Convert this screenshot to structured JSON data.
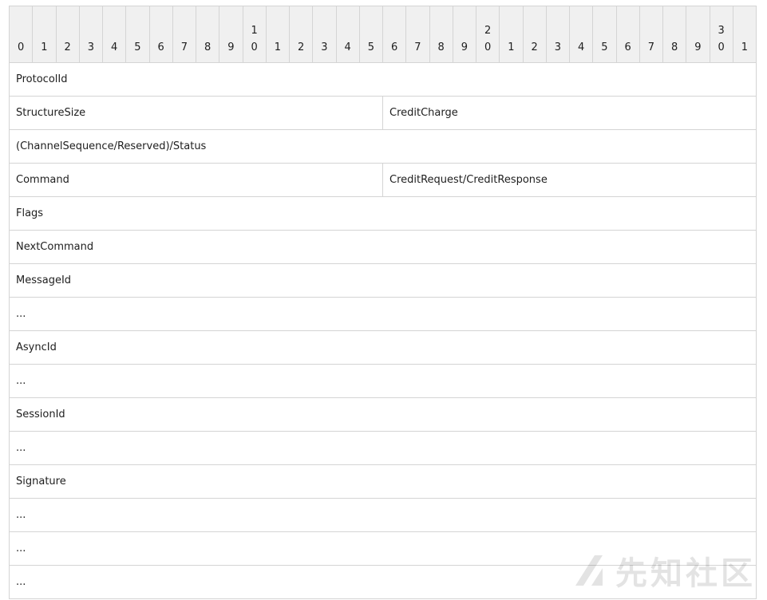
{
  "header_bits": [
    "0",
    "1",
    "2",
    "3",
    "4",
    "5",
    "6",
    "7",
    "8",
    "9",
    "10",
    "1",
    "2",
    "3",
    "4",
    "5",
    "6",
    "7",
    "8",
    "9",
    "20",
    "1",
    "2",
    "3",
    "4",
    "5",
    "6",
    "7",
    "8",
    "9",
    "30",
    "1"
  ],
  "rows": [
    {
      "cells": [
        {
          "label": "ProtocolId",
          "span": 32
        }
      ]
    },
    {
      "cells": [
        {
          "label": "StructureSize",
          "span": 16
        },
        {
          "label": "CreditCharge",
          "span": 16
        }
      ]
    },
    {
      "cells": [
        {
          "label": "(ChannelSequence/Reserved)/Status",
          "span": 32
        }
      ]
    },
    {
      "cells": [
        {
          "label": "Command",
          "span": 16
        },
        {
          "label": "CreditRequest/CreditResponse",
          "span": 16
        }
      ]
    },
    {
      "cells": [
        {
          "label": "Flags",
          "span": 32
        }
      ]
    },
    {
      "cells": [
        {
          "label": "NextCommand",
          "span": 32
        }
      ]
    },
    {
      "cells": [
        {
          "label": "MessageId",
          "span": 32
        }
      ]
    },
    {
      "cells": [
        {
          "label": "...",
          "span": 32
        }
      ]
    },
    {
      "cells": [
        {
          "label": "AsyncId",
          "span": 32
        }
      ]
    },
    {
      "cells": [
        {
          "label": "...",
          "span": 32
        }
      ]
    },
    {
      "cells": [
        {
          "label": "SessionId",
          "span": 32
        }
      ]
    },
    {
      "cells": [
        {
          "label": "...",
          "span": 32
        }
      ]
    },
    {
      "cells": [
        {
          "label": "Signature",
          "span": 32
        }
      ]
    },
    {
      "cells": [
        {
          "label": "...",
          "span": 32
        }
      ]
    },
    {
      "cells": [
        {
          "label": "...",
          "span": 32
        }
      ]
    },
    {
      "cells": [
        {
          "label": "...",
          "span": 32
        }
      ]
    }
  ],
  "watermark": {
    "text": "先知社区",
    "icon": "xianzhi-logo-icon"
  }
}
